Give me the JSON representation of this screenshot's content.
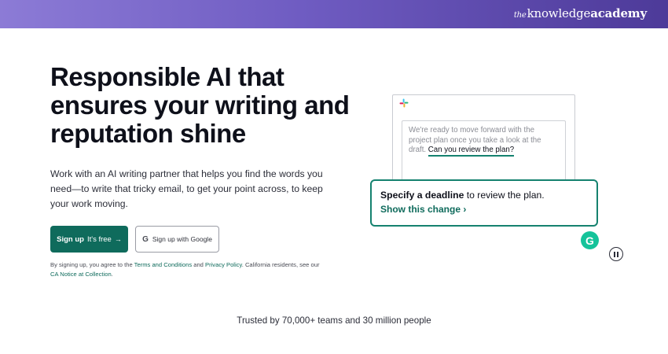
{
  "banner": {
    "brand_the": "the",
    "brand_knowledge": "knowledge",
    "brand_academy": "academy"
  },
  "hero": {
    "headline": "Responsible AI that ensures your writing and reputation shine",
    "subtext": "Work with an AI writing partner that helps you find the words you need—to write that tricky email, to get your point across, to keep your work moving."
  },
  "buttons": {
    "signup_label": "Sign up",
    "signup_free": "It's free",
    "signup_arrow": "→",
    "google_icon": "G",
    "google_label": "Sign up with Google"
  },
  "legal": {
    "text_1": "By signing up, you agree to the ",
    "terms_link": "Terms and Conditions",
    "text_2": " and ",
    "privacy_link": "Privacy Policy",
    "text_3": ". California residents, see our ",
    "ca_link": "CA Notice at Collection",
    "text_4": "."
  },
  "demo": {
    "message_text": "We're ready to move forward with the project plan once you take a look at the draft. ",
    "highlighted_text": "Can you review the plan?",
    "suggestion_bold": "Specify a deadline",
    "suggestion_rest": " to review the plan.",
    "suggestion_action": "Show this change ›",
    "badge_letter": "G",
    "accent_color": "#15826f",
    "slack_icon": "slack-icon"
  },
  "trusted": {
    "text": "Trusted by 70,000+ teams and 30 million people"
  }
}
